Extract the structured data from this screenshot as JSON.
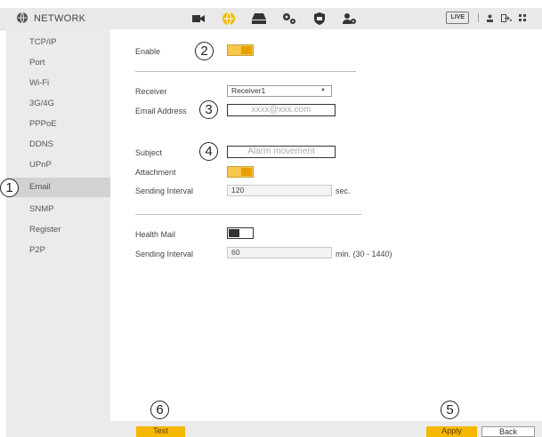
{
  "header": {
    "title": "NETWORK",
    "live_label": "LIVE",
    "nav_icons": [
      "camera-icon",
      "network-icon",
      "storage-icon",
      "system-icon",
      "security-icon",
      "account-icon"
    ]
  },
  "sidebar": {
    "items": [
      {
        "label": "TCP/IP"
      },
      {
        "label": "Port"
      },
      {
        "label": "Wi-Fi"
      },
      {
        "label": "3G/4G"
      },
      {
        "label": "PPPoE"
      },
      {
        "label": "DDNS"
      },
      {
        "label": "UPnP"
      },
      {
        "label": "Email",
        "active": true
      },
      {
        "label": "SNMP"
      },
      {
        "label": "Register"
      },
      {
        "label": "P2P"
      }
    ]
  },
  "form": {
    "enable_label": "Enable",
    "enable_on": true,
    "receiver_label": "Receiver",
    "receiver_value": "Receiver1",
    "email_label": "Email Address",
    "email_placeholder": "xxxx@xxx.com",
    "subject_label": "Subject",
    "subject_placeholder": "Alarm movement",
    "attachment_label": "Attachment",
    "attachment_on": true,
    "sending_interval_label": "Sending Interval",
    "sending_interval_value": "120",
    "sending_interval_unit": "sec.",
    "health_mail_label": "Health Mail",
    "health_mail_on": false,
    "health_interval_label": "Sending Interval",
    "health_interval_value": "60",
    "health_interval_unit": "min. (30 - 1440)"
  },
  "buttons": {
    "test": "Test",
    "apply": "Apply",
    "back": "Back"
  },
  "callouts": [
    "1",
    "2",
    "3",
    "4",
    "5",
    "6"
  ],
  "colors": {
    "accent": "#f5b800",
    "toggle_on": "#e8a100",
    "sidebar_bg": "#ebebeb",
    "sidebar_active": "#d2d2d2"
  }
}
